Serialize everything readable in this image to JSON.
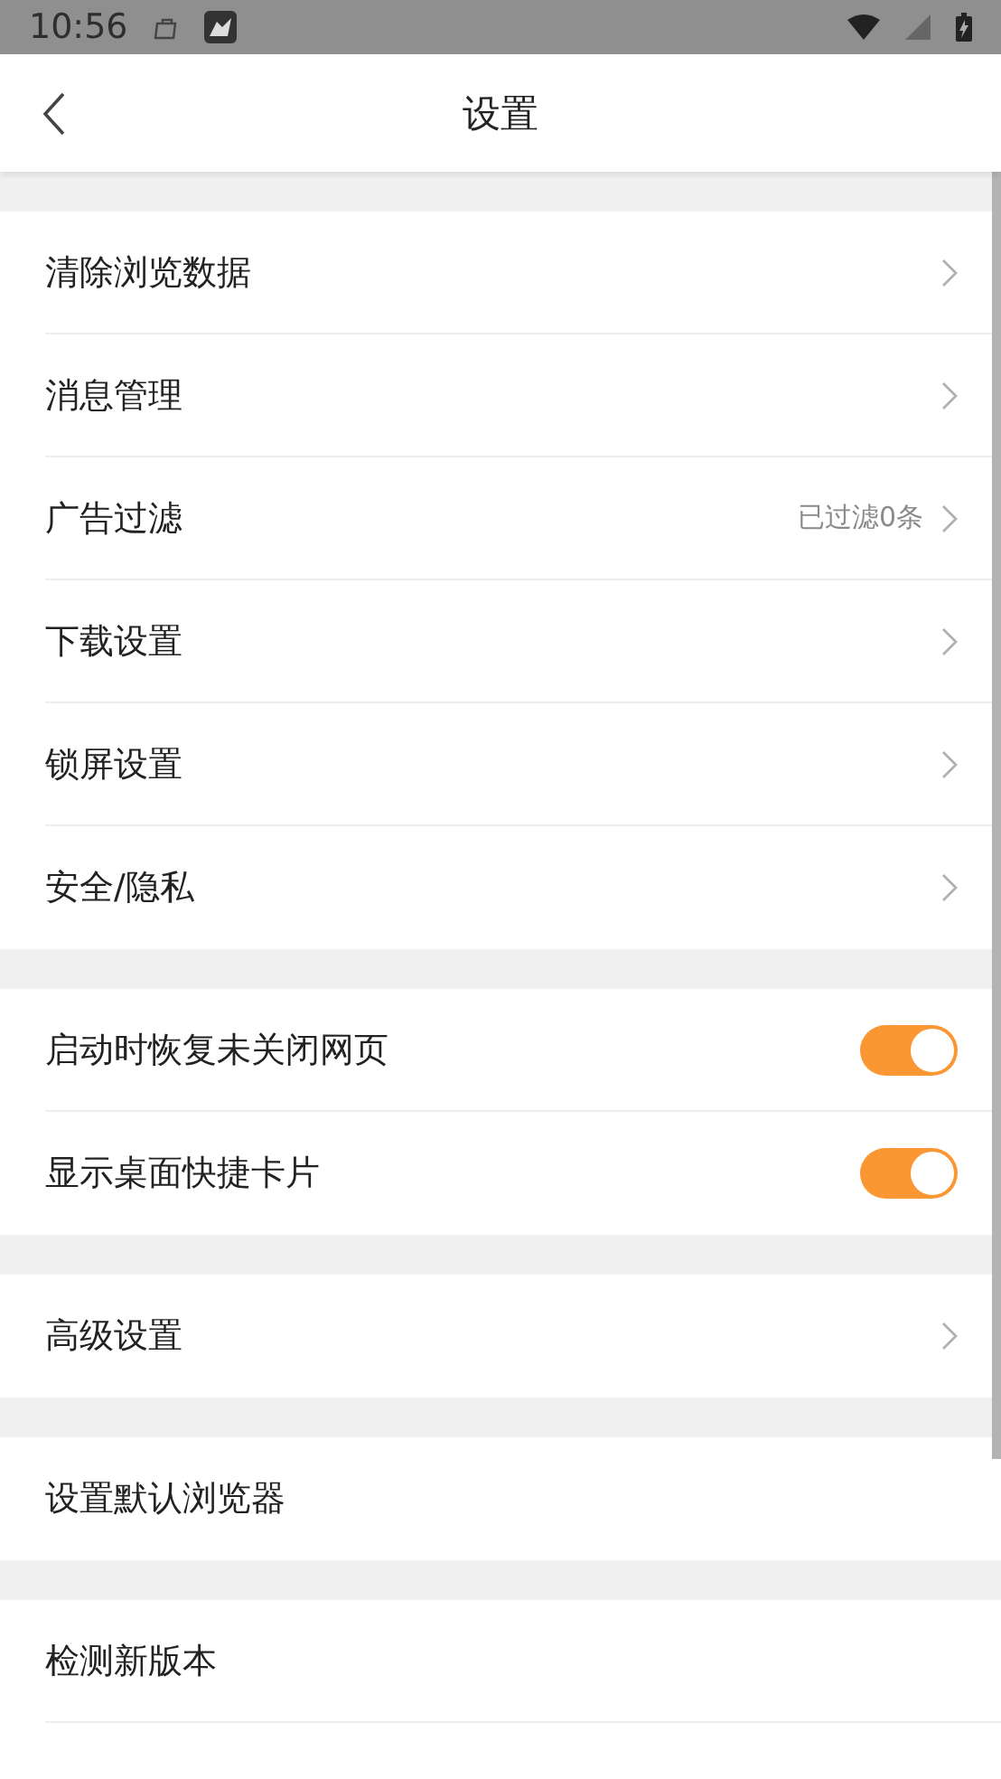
{
  "status_bar": {
    "time": "10:56"
  },
  "header": {
    "title": "设置"
  },
  "groups": [
    {
      "items": [
        {
          "kind": "link",
          "label": "清除浏览数据"
        },
        {
          "kind": "link",
          "label": "消息管理"
        },
        {
          "kind": "link",
          "label": "广告过滤",
          "value": "已过滤0条"
        },
        {
          "kind": "link",
          "label": "下载设置"
        },
        {
          "kind": "link",
          "label": "锁屏设置"
        },
        {
          "kind": "link",
          "label": "安全/隐私"
        }
      ]
    },
    {
      "items": [
        {
          "kind": "toggle",
          "label": "启动时恢复未关闭网页",
          "on": true
        },
        {
          "kind": "toggle",
          "label": "显示桌面快捷卡片",
          "on": true
        }
      ]
    },
    {
      "items": [
        {
          "kind": "link",
          "label": "高级设置"
        }
      ]
    },
    {
      "items": [
        {
          "kind": "plain",
          "label": "设置默认浏览器"
        }
      ]
    },
    {
      "items": [
        {
          "kind": "plain",
          "label": "检测新版本"
        }
      ]
    }
  ]
}
